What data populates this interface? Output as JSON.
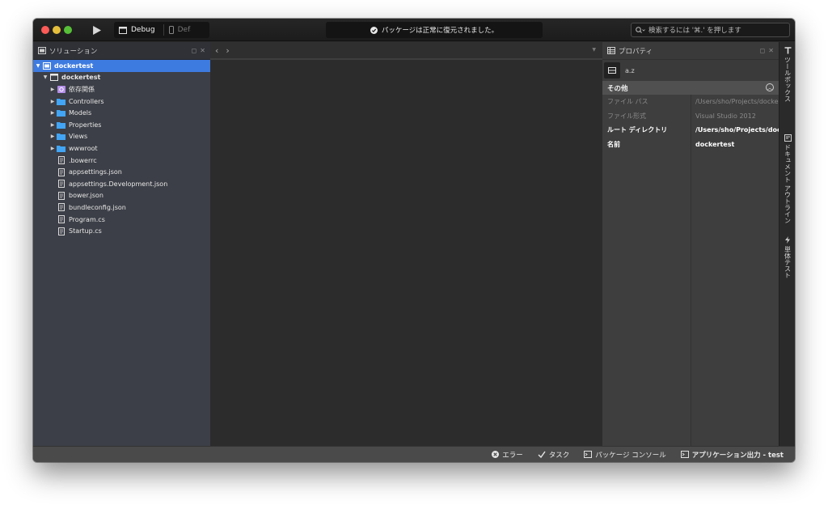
{
  "toolbar": {
    "config_label": "Debug",
    "target_label": "Defa",
    "status_message": "パッケージは正常に復元されました。",
    "search_placeholder": "検索するには '⌘.' を押します"
  },
  "solution_pad": {
    "title": "ソリューション",
    "items": [
      {
        "label": "dockertest",
        "icon": "solution-icon",
        "indent": 0,
        "arrow": "down",
        "selected": true
      },
      {
        "label": "dockertest",
        "icon": "project-icon",
        "indent": 1,
        "arrow": "down",
        "bold": true
      },
      {
        "label": "依存関係",
        "icon": "dependencies-icon",
        "indent": 2,
        "arrow": "right"
      },
      {
        "label": "Controllers",
        "icon": "folder-icon",
        "indent": 2,
        "arrow": "right"
      },
      {
        "label": "Models",
        "icon": "folder-icon",
        "indent": 2,
        "arrow": "right"
      },
      {
        "label": "Properties",
        "icon": "folder-icon",
        "indent": 2,
        "arrow": "right"
      },
      {
        "label": "Views",
        "icon": "folder-icon",
        "indent": 2,
        "arrow": "right"
      },
      {
        "label": "wwwroot",
        "icon": "folder-icon",
        "indent": 2,
        "arrow": "right"
      },
      {
        "label": ".bowerrc",
        "icon": "file-icon",
        "indent": 2,
        "arrow": "none"
      },
      {
        "label": "appsettings.json",
        "icon": "file-icon",
        "indent": 2,
        "arrow": "none"
      },
      {
        "label": "appsettings.Development.json",
        "icon": "file-icon",
        "indent": 2,
        "arrow": "none"
      },
      {
        "label": "bower.json",
        "icon": "file-icon",
        "indent": 2,
        "arrow": "none"
      },
      {
        "label": "bundleconfig.json",
        "icon": "file-icon",
        "indent": 2,
        "arrow": "none"
      },
      {
        "label": "Program.cs",
        "icon": "file-icon",
        "indent": 2,
        "arrow": "none"
      },
      {
        "label": "Startup.cs",
        "icon": "file-icon",
        "indent": 2,
        "arrow": "none"
      }
    ]
  },
  "properties_pad": {
    "title": "プロパティ",
    "sort_label": "a.z",
    "category": "その他",
    "rows": [
      {
        "name": "ファイル パス",
        "value": "/Users/sho/Projects/dockertest",
        "style": "dim"
      },
      {
        "name": "ファイル形式",
        "value": "Visual Studio 2012",
        "style": "dim"
      },
      {
        "name": "ルート ディレクトリ",
        "value": "/Users/sho/Projects/dockertest",
        "style": "bright"
      },
      {
        "name": "名前",
        "value": "dockertest",
        "style": "bright"
      }
    ]
  },
  "dock": {
    "toolbox": "ツールボックス",
    "document_outline": "ドキュメント アウトライン",
    "unit_test": "単体テスト"
  },
  "statusbar": {
    "errors": "エラー",
    "tasks": "タスク",
    "package_console": "パッケージ コンソール",
    "app_output": "アプリケーション出力 - test"
  },
  "colors": {
    "selection": "#3e7be0",
    "folder": "#42a5f5",
    "dependencies": "#b48ee8"
  }
}
